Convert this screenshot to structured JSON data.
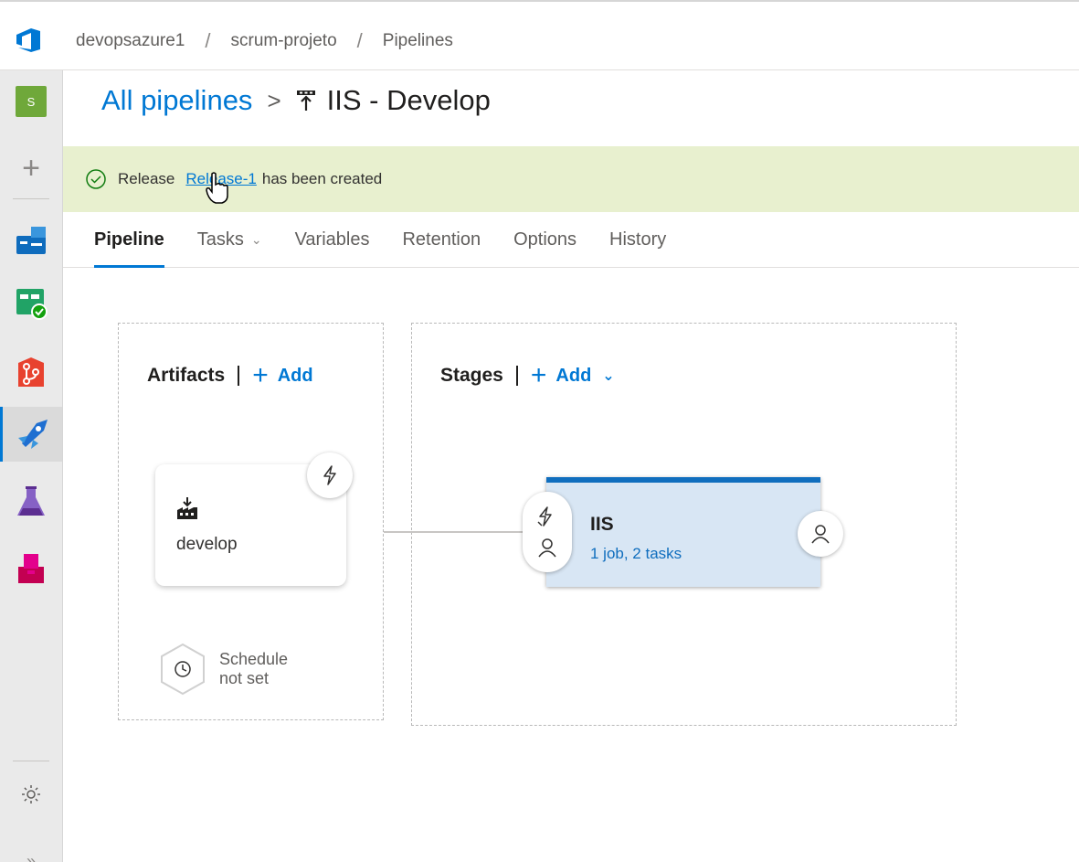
{
  "breadcrumb": {
    "items": [
      "devopsazure1",
      "scrum-projeto",
      "Pipelines"
    ],
    "separator": "/"
  },
  "leftnav": {
    "avatar_letter": "S",
    "items": [
      "overview-icon",
      "boards-icon",
      "repos-icon",
      "pipelines-icon",
      "testplans-icon",
      "artifacts-icon"
    ]
  },
  "header": {
    "parent": "All pipelines",
    "chevron": ">",
    "title": "IIS - Develop"
  },
  "banner": {
    "prefix": "Release",
    "link": "Release-1",
    "suffix": "has been created"
  },
  "tabs": [
    {
      "label": "Pipeline",
      "active": true
    },
    {
      "label": "Tasks",
      "dropdown": true
    },
    {
      "label": "Variables"
    },
    {
      "label": "Retention"
    },
    {
      "label": "Options"
    },
    {
      "label": "History"
    }
  ],
  "artifacts": {
    "title": "Artifacts",
    "add_label": "Add",
    "artifact_name": "develop",
    "schedule_line1": "Schedule",
    "schedule_line2": "not set"
  },
  "stages": {
    "title": "Stages",
    "add_label": "Add",
    "stage_name": "IIS",
    "stage_desc": "1 job, 2 tasks"
  },
  "colors": {
    "accent": "#0078d4",
    "banner_bg": "#e8f0cf",
    "stage_bg": "#d8e6f4",
    "stage_top": "#106ebe"
  }
}
